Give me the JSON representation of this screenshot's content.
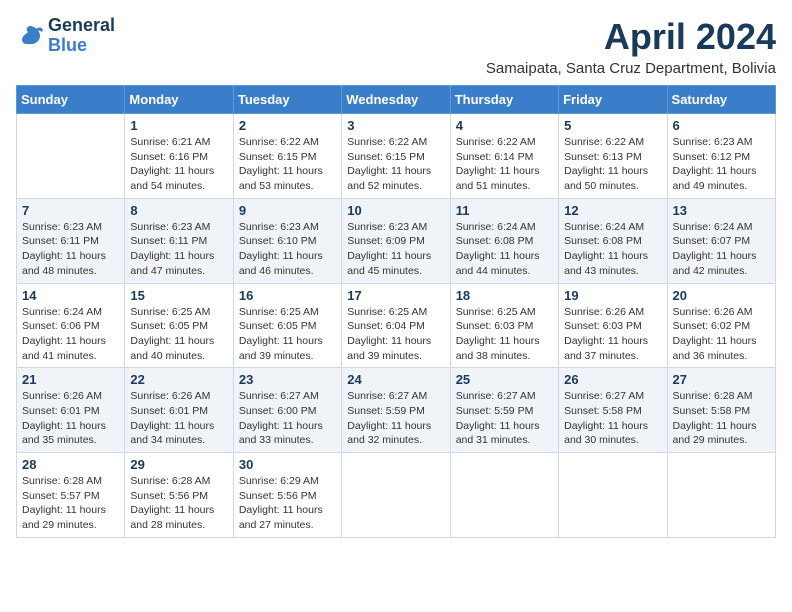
{
  "logo": {
    "line1": "General",
    "line2": "Blue"
  },
  "title": "April 2024",
  "location": "Samaipata, Santa Cruz Department, Bolivia",
  "weekdays": [
    "Sunday",
    "Monday",
    "Tuesday",
    "Wednesday",
    "Thursday",
    "Friday",
    "Saturday"
  ],
  "weeks": [
    [
      {
        "day": "",
        "sunrise": "",
        "sunset": "",
        "daylight": ""
      },
      {
        "day": "1",
        "sunrise": "Sunrise: 6:21 AM",
        "sunset": "Sunset: 6:16 PM",
        "daylight": "Daylight: 11 hours and 54 minutes."
      },
      {
        "day": "2",
        "sunrise": "Sunrise: 6:22 AM",
        "sunset": "Sunset: 6:15 PM",
        "daylight": "Daylight: 11 hours and 53 minutes."
      },
      {
        "day": "3",
        "sunrise": "Sunrise: 6:22 AM",
        "sunset": "Sunset: 6:15 PM",
        "daylight": "Daylight: 11 hours and 52 minutes."
      },
      {
        "day": "4",
        "sunrise": "Sunrise: 6:22 AM",
        "sunset": "Sunset: 6:14 PM",
        "daylight": "Daylight: 11 hours and 51 minutes."
      },
      {
        "day": "5",
        "sunrise": "Sunrise: 6:22 AM",
        "sunset": "Sunset: 6:13 PM",
        "daylight": "Daylight: 11 hours and 50 minutes."
      },
      {
        "day": "6",
        "sunrise": "Sunrise: 6:23 AM",
        "sunset": "Sunset: 6:12 PM",
        "daylight": "Daylight: 11 hours and 49 minutes."
      }
    ],
    [
      {
        "day": "7",
        "sunrise": "Sunrise: 6:23 AM",
        "sunset": "Sunset: 6:11 PM",
        "daylight": "Daylight: 11 hours and 48 minutes."
      },
      {
        "day": "8",
        "sunrise": "Sunrise: 6:23 AM",
        "sunset": "Sunset: 6:11 PM",
        "daylight": "Daylight: 11 hours and 47 minutes."
      },
      {
        "day": "9",
        "sunrise": "Sunrise: 6:23 AM",
        "sunset": "Sunset: 6:10 PM",
        "daylight": "Daylight: 11 hours and 46 minutes."
      },
      {
        "day": "10",
        "sunrise": "Sunrise: 6:23 AM",
        "sunset": "Sunset: 6:09 PM",
        "daylight": "Daylight: 11 hours and 45 minutes."
      },
      {
        "day": "11",
        "sunrise": "Sunrise: 6:24 AM",
        "sunset": "Sunset: 6:08 PM",
        "daylight": "Daylight: 11 hours and 44 minutes."
      },
      {
        "day": "12",
        "sunrise": "Sunrise: 6:24 AM",
        "sunset": "Sunset: 6:08 PM",
        "daylight": "Daylight: 11 hours and 43 minutes."
      },
      {
        "day": "13",
        "sunrise": "Sunrise: 6:24 AM",
        "sunset": "Sunset: 6:07 PM",
        "daylight": "Daylight: 11 hours and 42 minutes."
      }
    ],
    [
      {
        "day": "14",
        "sunrise": "Sunrise: 6:24 AM",
        "sunset": "Sunset: 6:06 PM",
        "daylight": "Daylight: 11 hours and 41 minutes."
      },
      {
        "day": "15",
        "sunrise": "Sunrise: 6:25 AM",
        "sunset": "Sunset: 6:05 PM",
        "daylight": "Daylight: 11 hours and 40 minutes."
      },
      {
        "day": "16",
        "sunrise": "Sunrise: 6:25 AM",
        "sunset": "Sunset: 6:05 PM",
        "daylight": "Daylight: 11 hours and 39 minutes."
      },
      {
        "day": "17",
        "sunrise": "Sunrise: 6:25 AM",
        "sunset": "Sunset: 6:04 PM",
        "daylight": "Daylight: 11 hours and 39 minutes."
      },
      {
        "day": "18",
        "sunrise": "Sunrise: 6:25 AM",
        "sunset": "Sunset: 6:03 PM",
        "daylight": "Daylight: 11 hours and 38 minutes."
      },
      {
        "day": "19",
        "sunrise": "Sunrise: 6:26 AM",
        "sunset": "Sunset: 6:03 PM",
        "daylight": "Daylight: 11 hours and 37 minutes."
      },
      {
        "day": "20",
        "sunrise": "Sunrise: 6:26 AM",
        "sunset": "Sunset: 6:02 PM",
        "daylight": "Daylight: 11 hours and 36 minutes."
      }
    ],
    [
      {
        "day": "21",
        "sunrise": "Sunrise: 6:26 AM",
        "sunset": "Sunset: 6:01 PM",
        "daylight": "Daylight: 11 hours and 35 minutes."
      },
      {
        "day": "22",
        "sunrise": "Sunrise: 6:26 AM",
        "sunset": "Sunset: 6:01 PM",
        "daylight": "Daylight: 11 hours and 34 minutes."
      },
      {
        "day": "23",
        "sunrise": "Sunrise: 6:27 AM",
        "sunset": "Sunset: 6:00 PM",
        "daylight": "Daylight: 11 hours and 33 minutes."
      },
      {
        "day": "24",
        "sunrise": "Sunrise: 6:27 AM",
        "sunset": "Sunset: 5:59 PM",
        "daylight": "Daylight: 11 hours and 32 minutes."
      },
      {
        "day": "25",
        "sunrise": "Sunrise: 6:27 AM",
        "sunset": "Sunset: 5:59 PM",
        "daylight": "Daylight: 11 hours and 31 minutes."
      },
      {
        "day": "26",
        "sunrise": "Sunrise: 6:27 AM",
        "sunset": "Sunset: 5:58 PM",
        "daylight": "Daylight: 11 hours and 30 minutes."
      },
      {
        "day": "27",
        "sunrise": "Sunrise: 6:28 AM",
        "sunset": "Sunset: 5:58 PM",
        "daylight": "Daylight: 11 hours and 29 minutes."
      }
    ],
    [
      {
        "day": "28",
        "sunrise": "Sunrise: 6:28 AM",
        "sunset": "Sunset: 5:57 PM",
        "daylight": "Daylight: 11 hours and 29 minutes."
      },
      {
        "day": "29",
        "sunrise": "Sunrise: 6:28 AM",
        "sunset": "Sunset: 5:56 PM",
        "daylight": "Daylight: 11 hours and 28 minutes."
      },
      {
        "day": "30",
        "sunrise": "Sunrise: 6:29 AM",
        "sunset": "Sunset: 5:56 PM",
        "daylight": "Daylight: 11 hours and 27 minutes."
      },
      {
        "day": "",
        "sunrise": "",
        "sunset": "",
        "daylight": ""
      },
      {
        "day": "",
        "sunrise": "",
        "sunset": "",
        "daylight": ""
      },
      {
        "day": "",
        "sunrise": "",
        "sunset": "",
        "daylight": ""
      },
      {
        "day": "",
        "sunrise": "",
        "sunset": "",
        "daylight": ""
      }
    ]
  ]
}
